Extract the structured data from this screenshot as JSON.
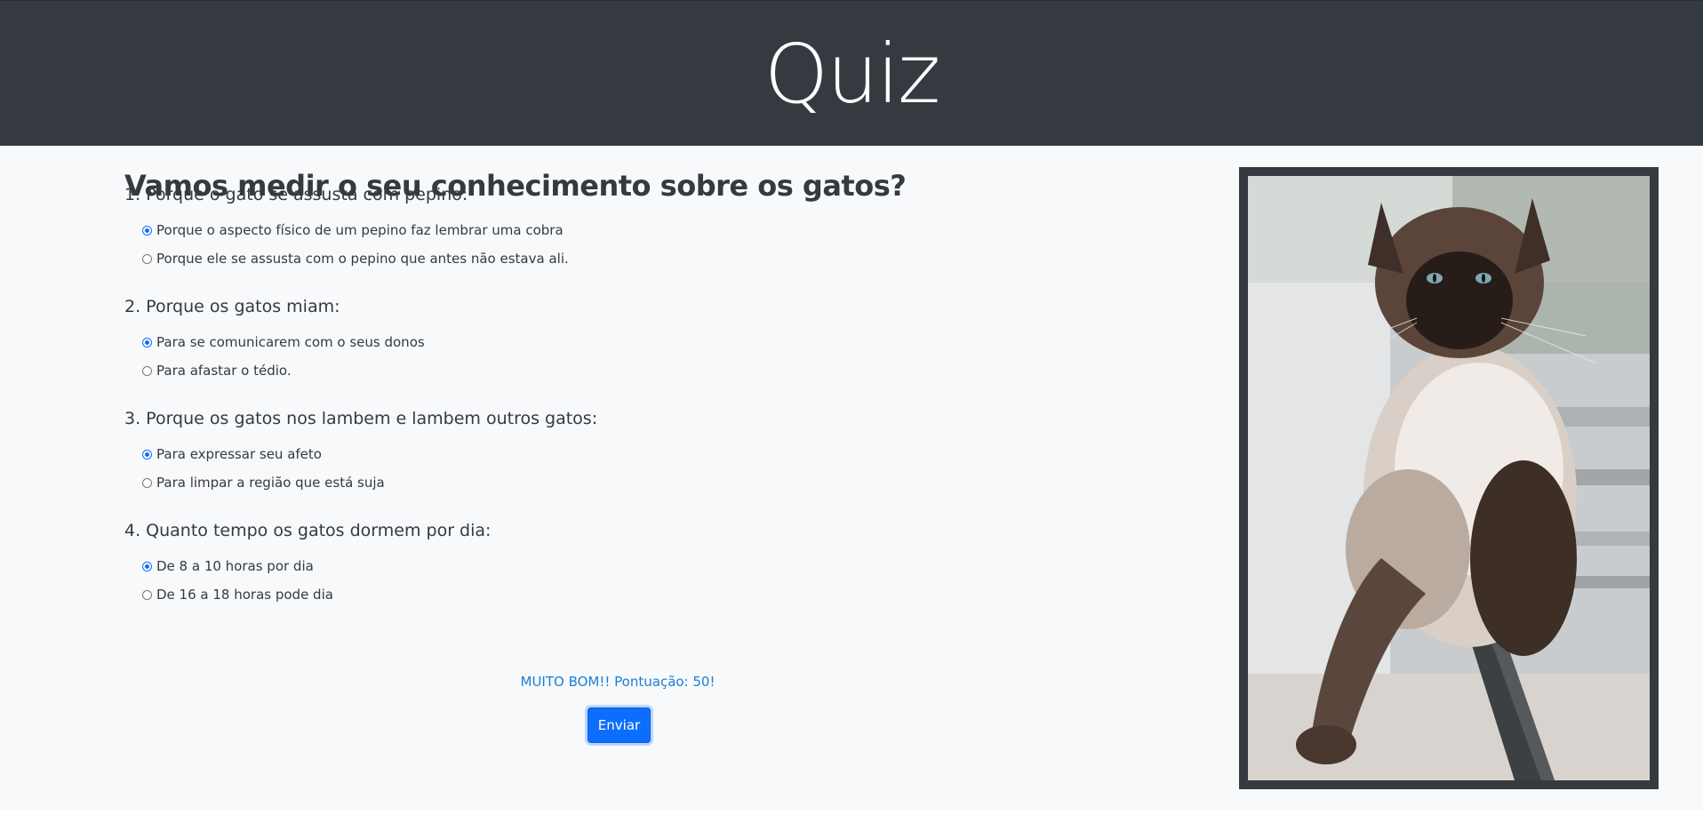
{
  "header": {
    "title": "Quiz"
  },
  "intro": "Vamos medir o seu conhecimento sobre os gatos?",
  "questions": [
    {
      "label": "1. Porque o gato se assusta com pepino:",
      "options": [
        {
          "label": "Porque o aspecto físico de um pepino faz lembrar uma cobra",
          "checked": true
        },
        {
          "label": "Porque ele se assusta com o pepino que antes não estava ali.",
          "checked": false
        }
      ]
    },
    {
      "label": "2. Porque os gatos miam:",
      "options": [
        {
          "label": "Para se comunicarem com o seus donos",
          "checked": true
        },
        {
          "label": "Para afastar o tédio.",
          "checked": false
        }
      ]
    },
    {
      "label": "3. Porque os gatos nos lambem e lambem outros gatos:",
      "options": [
        {
          "label": "Para expressar seu afeto",
          "checked": true
        },
        {
          "label": "Para limpar a região que está suja",
          "checked": false
        }
      ]
    },
    {
      "label": "4. Quanto tempo os gatos dormem por dia:",
      "options": [
        {
          "label": "De 8 a 10 horas por dia",
          "checked": true
        },
        {
          "label": "De 16 a 18 horas pode dia",
          "checked": false
        }
      ]
    }
  ],
  "result": "MUITO BOM!! Pontuação: 50!",
  "submit_label": "Enviar",
  "image": {
    "icon": "cat-photo"
  },
  "colors": {
    "header_bg": "#343a40",
    "page_bg": "#f8f9fa",
    "accent": "#0d6efd",
    "score_text": "#1a7fd9"
  }
}
